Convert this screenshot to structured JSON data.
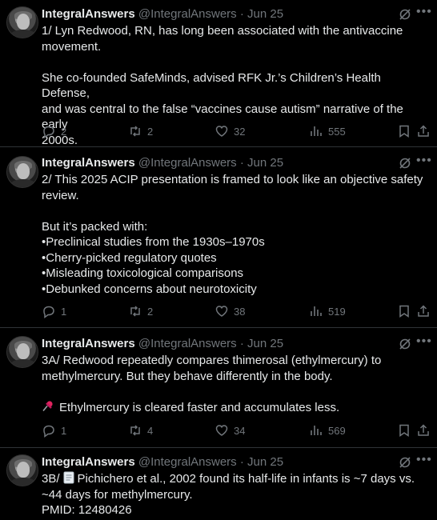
{
  "tweets": [
    {
      "author": "IntegralAnswers",
      "handle": "@IntegralAnswers",
      "dot": "·",
      "date": "Jun 25",
      "lines": [
        "1/ Lyn Redwood, RN, has long been associated with the antivaccine",
        "movement.",
        "",
        "She co-founded SafeMinds, advised RFK Jr.’s Children’s Health Defense,",
        "and was central to the false “vaccines cause autism” narrative of the early",
        "2000s."
      ],
      "replies": "2",
      "reposts": "2",
      "likes": "32",
      "views": "555"
    },
    {
      "author": "IntegralAnswers",
      "handle": "@IntegralAnswers",
      "dot": "·",
      "date": "Jun 25",
      "lines": [
        "2/ This 2025 ACIP presentation is framed to look like an objective safety",
        "review.",
        "",
        "But it’s packed with:",
        "•Preclinical studies from the 1930s–1970s",
        "•Cherry-picked regulatory quotes",
        "•Misleading toxicological comparisons",
        "•Debunked concerns about neurotoxicity"
      ],
      "replies": "1",
      "reposts": "2",
      "likes": "38",
      "views": "519"
    },
    {
      "author": "IntegralAnswers",
      "handle": "@IntegralAnswers",
      "dot": "·",
      "date": "Jun 25",
      "lines": [
        "3A/ Redwood repeatedly compares thimerosal (ethylmercury) to",
        "methylmercury. But they behave differently in the body.",
        ""
      ],
      "emoji_line": "Ethylmercury is cleared faster and accumulates less.",
      "replies": "1",
      "reposts": "4",
      "likes": "34",
      "views": "569"
    },
    {
      "author": "IntegralAnswers",
      "handle": "@IntegralAnswers",
      "dot": "·",
      "date": "Jun 25",
      "line1_prefix": "3B/",
      "line1_rest": "Pichichero et al., 2002 found its half-life in infants is ~7 days vs.",
      "lines": [
        "~44 days for methylmercury.",
        "PMID: 12480426"
      ]
    }
  ],
  "icons": {
    "grok": "grok-icon",
    "more": "more-icon",
    "reply": "reply-icon",
    "repost": "repost-icon",
    "like": "like-icon",
    "views": "views-icon",
    "bookmark": "bookmark-icon",
    "share": "share-icon",
    "pin": "pushpin-icon",
    "memo": "memo-icon"
  },
  "colors": {
    "background": "#000000",
    "text": "#e7e9ea",
    "muted": "#71767b",
    "divider": "#2f3336"
  }
}
